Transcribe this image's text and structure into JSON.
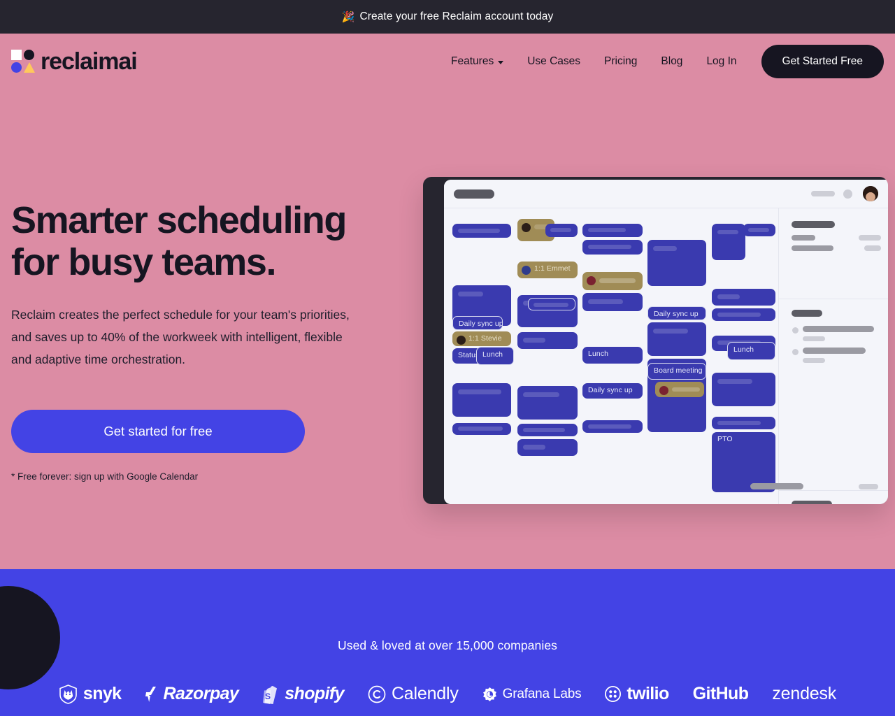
{
  "announcement": {
    "icon": "party-popper-icon",
    "text": "Create your free Reclaim account today"
  },
  "header": {
    "logo_text": "reclaimai",
    "nav": [
      {
        "label": "Features",
        "has_dropdown": true
      },
      {
        "label": "Use Cases",
        "has_dropdown": false
      },
      {
        "label": "Pricing",
        "has_dropdown": false
      },
      {
        "label": "Blog",
        "has_dropdown": false
      },
      {
        "label": "Log In",
        "has_dropdown": false
      }
    ],
    "cta_label": "Get Started Free"
  },
  "hero": {
    "headline_line1": "Smarter scheduling",
    "headline_line2": "for busy teams.",
    "subtext": "Reclaim creates the perfect schedule for your team's priorities, and saves up to 40% of the workweek with intelligent, flexible and adaptive time orchestration.",
    "cta_label": "Get started for free",
    "note": "* Free forever: sign up with Google Calendar"
  },
  "calendar_mock": {
    "labeled_events": [
      "Daily sync up",
      "1:1 Stevie",
      "Status r",
      "Lunch",
      "1:1 Emmet",
      "Lunch",
      "Daily sync up",
      "Daily sync up",
      "Lunch",
      "Board meeting",
      "PTO"
    ]
  },
  "social_proof": {
    "title": "Used & loved at over 15,000 companies",
    "logos": [
      {
        "name": "snyk",
        "label": "snyk"
      },
      {
        "name": "razorpay",
        "label": "Razorpay"
      },
      {
        "name": "shopify",
        "label": "shopify"
      },
      {
        "name": "calendly",
        "label": "Calendly"
      },
      {
        "name": "grafana-labs",
        "label": "Grafana Labs"
      },
      {
        "name": "twilio",
        "label": "twilio"
      },
      {
        "name": "github",
        "label": "GitHub"
      },
      {
        "name": "zendesk",
        "label": "zendesk"
      }
    ]
  },
  "colors": {
    "announce_bg": "#26252F",
    "hero_bg": "#DC8CA4",
    "brand_blue": "#4343E5",
    "ink": "#161521",
    "event_blue": "#3A3AAF",
    "event_tan": "#A08C56",
    "panel_bg": "#F4F5FA"
  }
}
